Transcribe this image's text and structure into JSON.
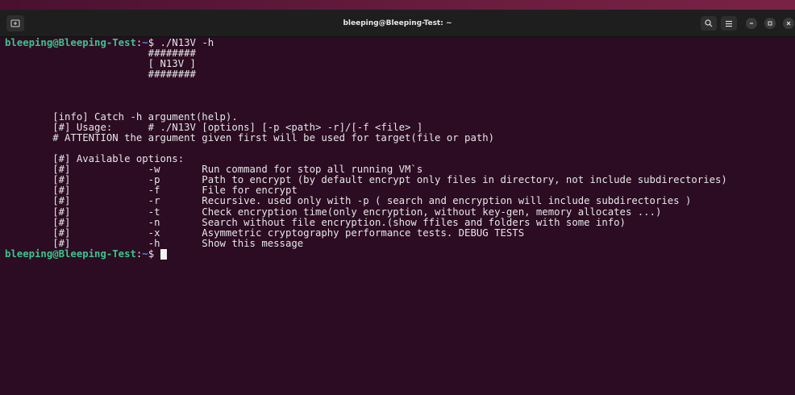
{
  "window": {
    "title": "bleeping@Bleeping-Test: ~",
    "background": "#2c0c23",
    "prompt_user_color": "#38c58a"
  },
  "toolbar": {
    "new_tab_icon": "new-tab-icon",
    "search_icon": "search-icon",
    "menu_icon": "hamburger-menu-icon",
    "minimize_icon": "minimize-icon",
    "maximize_icon": "maximize-icon",
    "close_icon": "close-icon"
  },
  "terminal": {
    "prompt": {
      "user_host": "bleeping@Bleeping-Test",
      "colon": ":",
      "path": "~",
      "symbol": "$ "
    },
    "command": "./N13V -h",
    "banner": [
      "                        ########",
      "                        [ N13V ]",
      "                        ########"
    ],
    "info": [
      "        [info] Catch -h argument(help).",
      "        [#] Usage:      # ./N13V [options] [-p <path> -r]/[-f <file> ]",
      "        # ATTENTION the argument given first will be used for target(file or path)"
    ],
    "options_header": "        [#] Available options:",
    "options": [
      "        [#]             -w       Run command for stop all running VM`s",
      "        [#]             -p       Path to encrypt (by default encrypt only files in directory, not include subdirectories)",
      "        [#]             -f       File for encrypt",
      "        [#]             -r       Recursive. used only with -p ( search and encryption will include subdirectories )",
      "        [#]             -t       Check encryption time(only encryption, without key-gen, memory allocates ...)",
      "        [#]             -n       Search without file encryption.(show ffiles and folders with some info)",
      "        [#]             -x       Asymmetric cryptography performance tests. DEBUG TESTS",
      "        [#]             -h       Show this message"
    ]
  }
}
